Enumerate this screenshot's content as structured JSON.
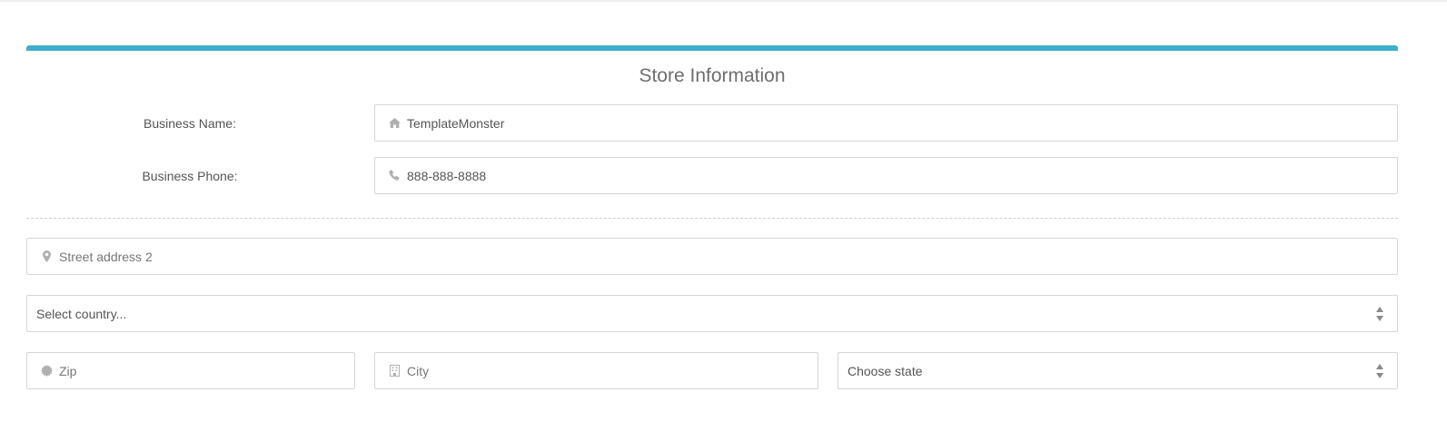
{
  "colors": {
    "accent": "#3bb0c9",
    "border": "#d6d6d6",
    "icon": "#b0b0b0"
  },
  "form": {
    "title": "Store Information",
    "business_name": {
      "label": "Business Name:",
      "value": "TemplateMonster",
      "icon": "home-icon"
    },
    "business_phone": {
      "label": "Business Phone:",
      "value": "888-888-8888",
      "icon": "phone-icon"
    },
    "street": {
      "placeholder": "Street address 2",
      "icon": "map-marker-icon"
    },
    "country": {
      "selected": "Select country..."
    },
    "zip": {
      "placeholder": "Zip",
      "icon": "certificate-icon"
    },
    "city": {
      "placeholder": "City",
      "icon": "building-icon"
    },
    "state": {
      "selected": "Choose state"
    }
  }
}
